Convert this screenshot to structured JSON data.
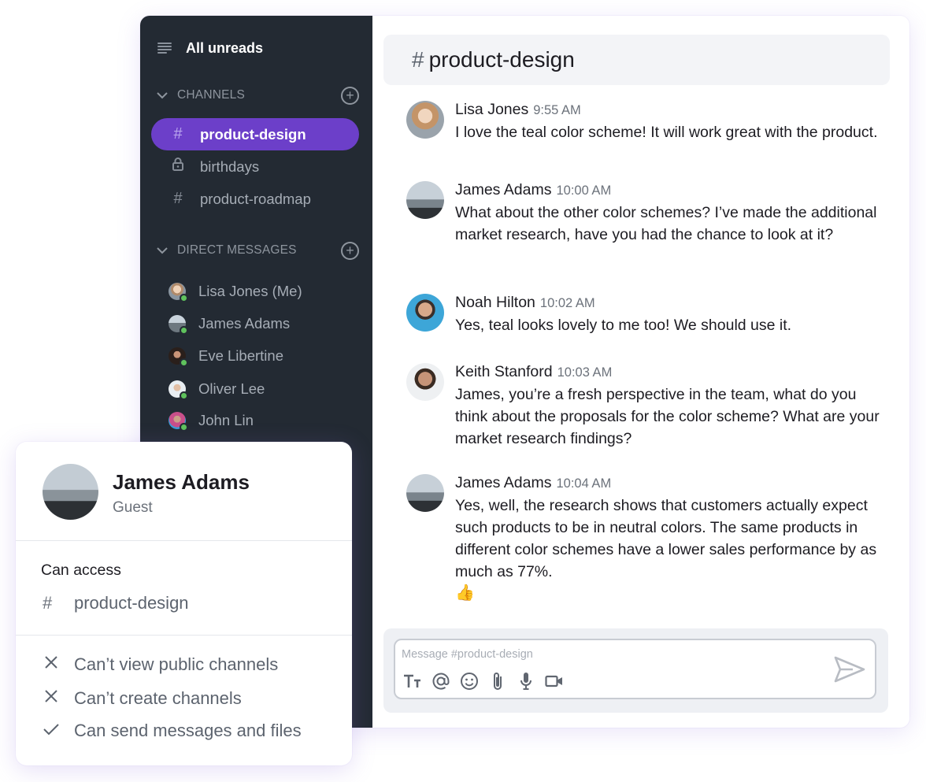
{
  "sidebar": {
    "all_unreads": "All unreads",
    "channels_title": "CHANNELS",
    "channels": [
      {
        "name": "product-design",
        "icon": "hash-icon",
        "active": true
      },
      {
        "name": "birthdays",
        "icon": "lock-icon",
        "active": false
      },
      {
        "name": "product-roadmap",
        "icon": "hash-icon",
        "active": false
      }
    ],
    "dms_title": "DIRECT MESSAGES",
    "dms": [
      {
        "name": "Lisa Jones (Me)",
        "status": "online"
      },
      {
        "name": "James Adams",
        "status": "online"
      },
      {
        "name": "Eve Libertine",
        "status": "online"
      },
      {
        "name": "Oliver Lee",
        "status": "online"
      },
      {
        "name": "John Lin",
        "status": "online"
      }
    ]
  },
  "channel": {
    "hash": "#",
    "title": "product-design"
  },
  "messages": [
    {
      "author": "Lisa Jones",
      "time": "9:55 AM",
      "text": "I love the teal color scheme! It will work great with the product."
    },
    {
      "author": "James Adams",
      "time": "10:00 AM",
      "text": "What about the other color schemes? I’ve made the additional market research, have you had the chance to look at it?"
    },
    {
      "author": "Noah Hilton",
      "time": "10:02 AM",
      "text": "Yes, teal looks lovely to me too! We should use it."
    },
    {
      "author": "Keith Stanford",
      "time": "10:03 AM",
      "text": "James, you’re a fresh perspective in the team, what do you think about the proposals for the color scheme? What are your market research findings?"
    },
    {
      "author": "James Adams",
      "time": "10:04 AM",
      "text": "Yes, well, the research shows that customers actually expect such products to be in neutral colors. The same products in different color schemes have a lower sales performance by as much as 77%.",
      "emoji": "👍"
    }
  ],
  "composer": {
    "placeholder": "Message #product-design"
  },
  "guest_card": {
    "name": "James Adams",
    "role": "Guest",
    "access_title": "Can access",
    "access_channel": "product-design",
    "permissions": [
      {
        "text": "Can’t view public channels",
        "allowed": false
      },
      {
        "text": "Can’t create channels",
        "allowed": false
      },
      {
        "text": "Can send messages and files",
        "allowed": true
      }
    ]
  },
  "colors": {
    "sidebar_bg": "#232a33",
    "accent": "#6c3fc9",
    "online": "#5fc25d"
  }
}
